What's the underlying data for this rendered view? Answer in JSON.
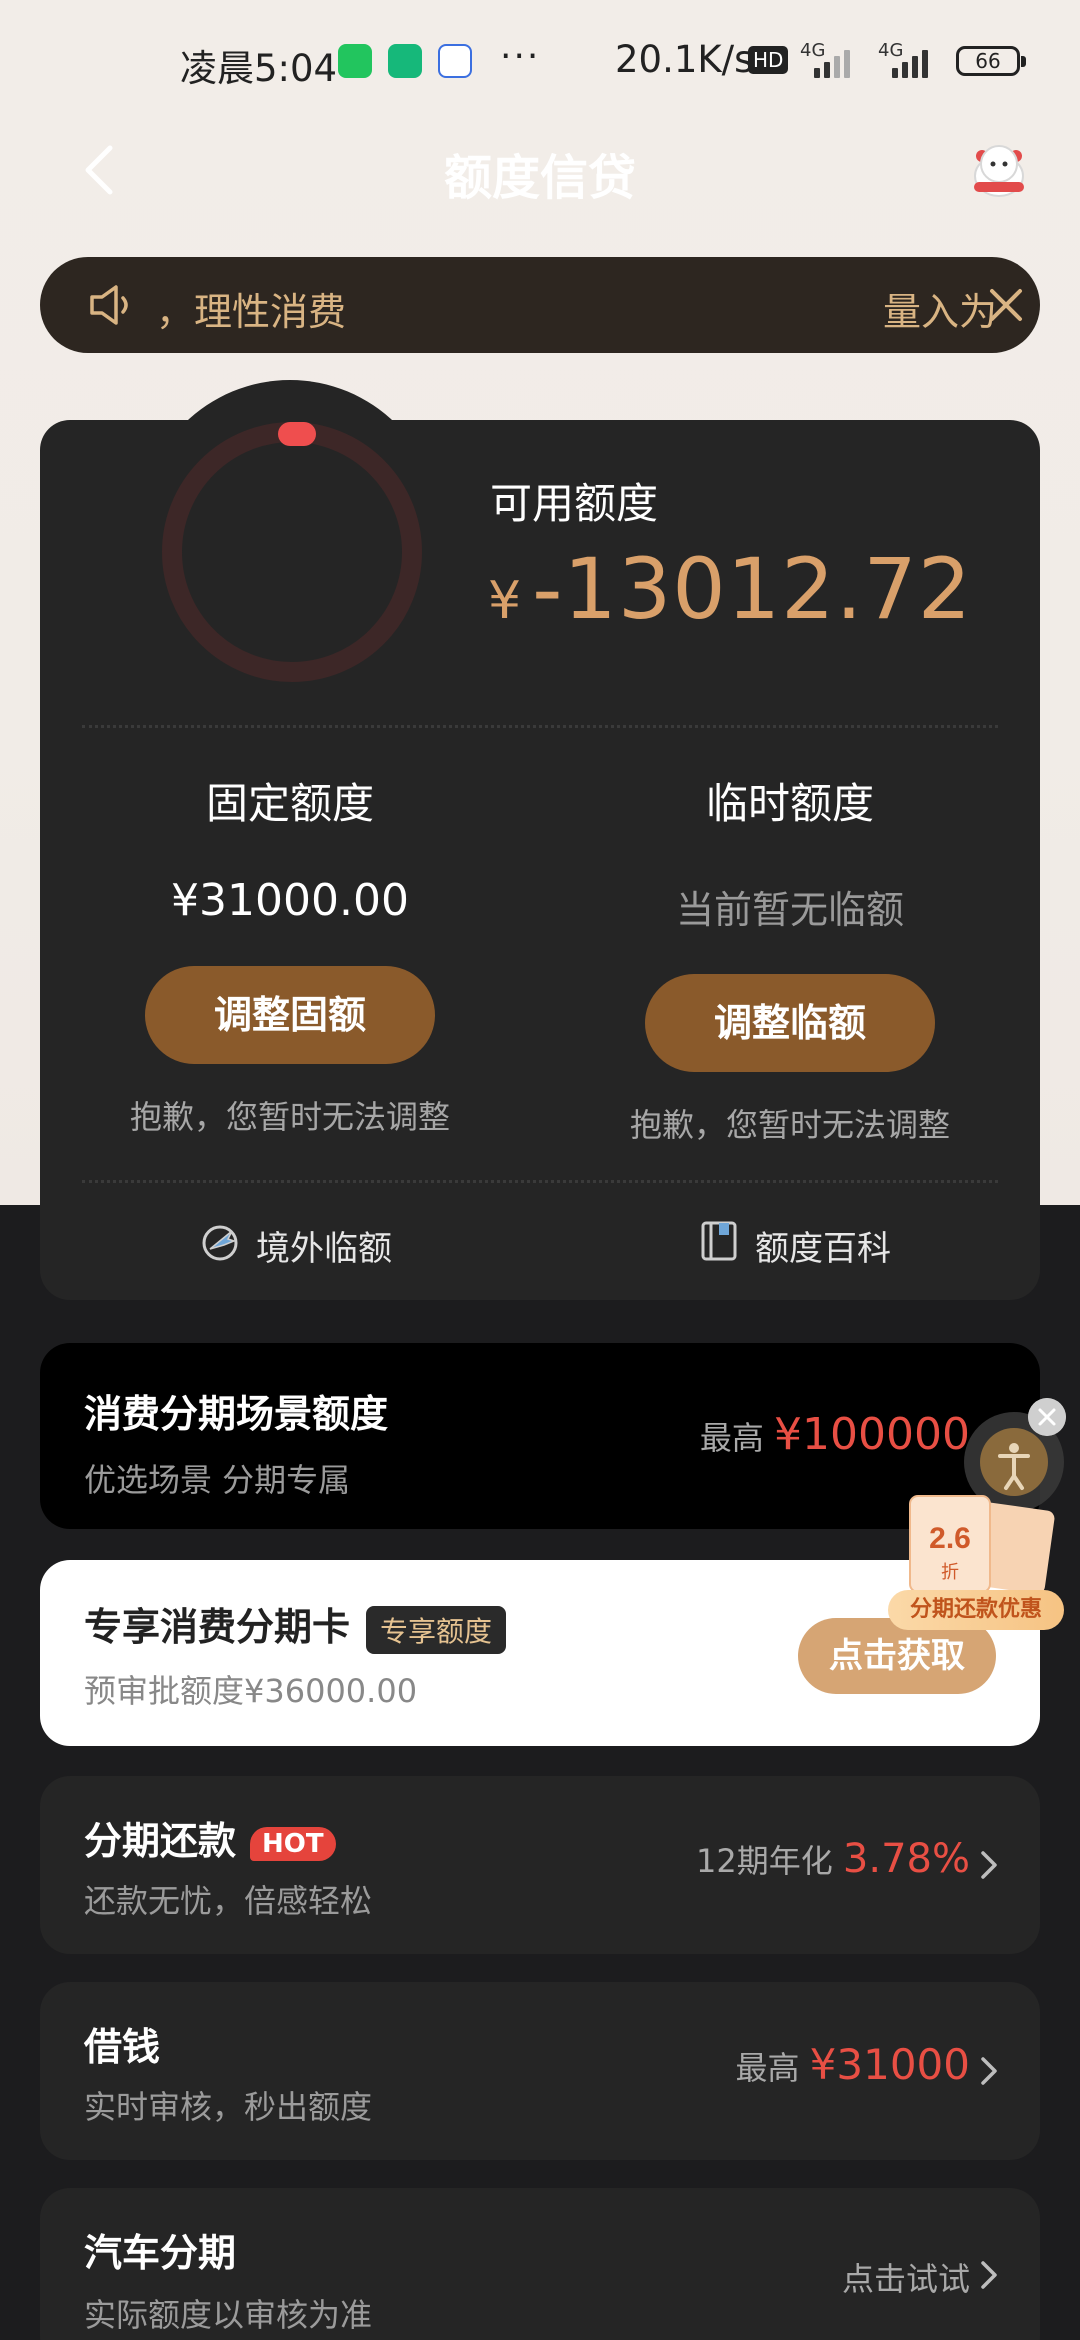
{
  "status_bar": {
    "time": "凌晨5:04",
    "dots": "···",
    "network_speed": "20.1K/s",
    "hd_label": "HD",
    "signal_label_1": "4G",
    "signal_label_2": "4G",
    "battery": "66"
  },
  "nav": {
    "title": "额度信贷"
  },
  "notice": {
    "text": "，理性消费",
    "text_tail": "量入为"
  },
  "credit": {
    "available_label": "可用额度",
    "available_currency": "¥",
    "available_amount": "-13012.72",
    "fixed_title": "固定额度",
    "fixed_value": "¥31000.00",
    "fixed_button": "调整固额",
    "fixed_note": "抱歉，您暂时无法调整",
    "temp_title": "临时额度",
    "temp_value": "当前暂无临额",
    "temp_button": "调整临额",
    "temp_note": "抱歉，您暂时无法调整",
    "overseas_link": "境外临额",
    "wiki_link": "额度百科"
  },
  "cards": {
    "installment_scene": {
      "title": "消费分期场景额度",
      "subtitle": "优选场景 分期专属",
      "right_prefix": "最高",
      "right_value": "¥100000"
    },
    "exclusive_card": {
      "title": "专享消费分期卡",
      "badge": "专享额度",
      "subtitle": "预审批额度¥36000.00",
      "button": "点击获取"
    },
    "installment_repay": {
      "title": "分期还款",
      "badge": "HOT",
      "subtitle": "还款无忧，倍感轻松",
      "right_prefix": "12期年化",
      "right_value": "3.78%"
    },
    "borrow": {
      "title": "借钱",
      "subtitle": "实时审核，秒出额度",
      "right_prefix": "最高",
      "right_value": "¥31000"
    },
    "car_installment": {
      "title": "汽车分期",
      "subtitle": "实际额度以审核为准",
      "right_text": "点击试试"
    }
  },
  "promo": {
    "discount": "2.6",
    "unit": "折",
    "label": "分期还款优惠"
  },
  "colors": {
    "accent_gold": "#d9a06a",
    "button_brown": "#8a5a2b",
    "highlight_red": "#e84f44"
  }
}
